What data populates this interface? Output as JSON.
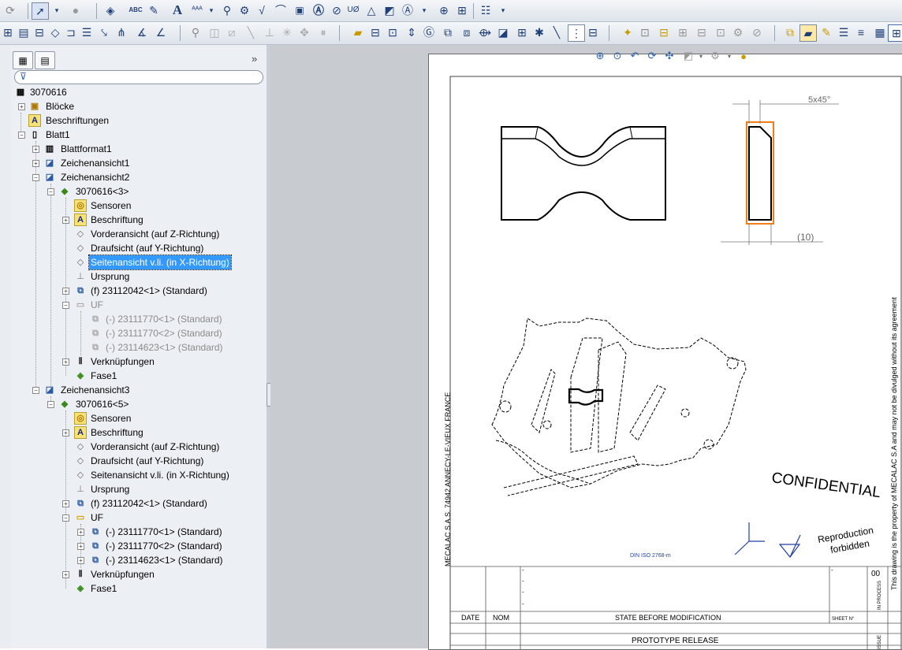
{
  "toolbar_top": {
    "icons": [
      "select-arrow-icon",
      "rebuild-icon",
      "smart-dimension-icon",
      "spell-check-icon",
      "format-painter-icon",
      "note-icon",
      "balloon-icon",
      "auto-balloon-icon",
      "surface-finish-icon",
      "weld-symbol-icon",
      "gtol-icon",
      "datum-feature-icon",
      "datum-target-icon",
      "hole-callout-icon",
      "revision-symbol-icon",
      "area-hatch-icon",
      "block-icon",
      "center-mark-icon",
      "centerline-icon",
      "table-icon"
    ],
    "spell_check_label": "ABC",
    "hole_symbol_label": "UØ"
  },
  "feature_tree": {
    "filter_placeholder": "",
    "root": "3070616",
    "nodes": {
      "bloecke": "Blöcke",
      "beschriftungen": "Beschriftungen",
      "blatt1": "Blatt1",
      "blattformat1": "Blattformat1",
      "zeichenansicht1": "Zeichenansicht1",
      "zeichenansicht2": "Zeichenansicht2",
      "part_a": "3070616<3>",
      "sensoren_a": "Sensoren",
      "beschriftung_a": "Beschriftung",
      "vorder_a": "Vorderansicht (auf Z-Richtung)",
      "drauf_a": "Draufsicht (auf Y-Richtung)",
      "seiten_a": "Seitenansicht v.li. (in X-Richtung)",
      "ursprung_a": "Ursprung",
      "comp_a": "(f) 23112042<1> (Standard)",
      "uf_a": "UF",
      "uf_a1": "(-) 23111770<1> (Standard)",
      "uf_a2": "(-) 23111770<2> (Standard)",
      "uf_a3": "(-) 23114623<1> (Standard)",
      "verk_a": "Verknüpfungen",
      "fase_a": "Fase1",
      "zeichenansicht3": "Zeichenansicht3",
      "part_b": "3070616<5>",
      "sensoren_b": "Sensoren",
      "beschriftung_b": "Beschriftung",
      "vorder_b": "Vorderansicht (auf Z-Richtung)",
      "drauf_b": "Draufsicht (auf Y-Richtung)",
      "seiten_b": "Seitenansicht v.li. (in X-Richtung)",
      "ursprung_b": "Ursprung",
      "comp_b": "(f) 23112042<1> (Standard)",
      "uf_b": "UF",
      "uf_b1": "(-) 23111770<1> (Standard)",
      "uf_b2": "(-) 23111770<2> (Standard)",
      "uf_b3": "(-) 23114623<1> (Standard)",
      "verk_b": "Verknüpfungen",
      "fase_b": "Fase1"
    },
    "selected": "Seitenansicht v.li. (in X-Richtung)"
  },
  "drawing": {
    "chamfer_dim": "5x45°",
    "thickness_dim": "(10)",
    "left_margin_text": "MECALAC S.A.S. 74942 ANNECY-LE-VIEUX FRANCE",
    "right_margin_text": "This drawing is the property of MECALAC S.A and may not be divulged without its agreement",
    "confidential": "CONFIDENTIAL",
    "reproduction_line1": "Reproduction",
    "reproduction_line2": "forbidden",
    "standard_label": "DIN ISO 2768-m",
    "title_block": {
      "col_date": "DATE",
      "col_nom": "NOM",
      "state_before": "STATE BEFORE MODIFICATION",
      "sheet_label": "SHEET N°",
      "revision": "00",
      "prototype": "PROTOTYPE RELEASE",
      "in_process": "IN PROCESS",
      "issue_label": "ISSUE",
      "dash_marks": [
        "-",
        "-",
        "-",
        "-",
        "-"
      ]
    }
  },
  "colors": {
    "selection": "#3399ff",
    "view_highlight": "#f07f1a",
    "sheet_bg": "#ffffff",
    "canvas_bg": "#c8cbd0"
  }
}
